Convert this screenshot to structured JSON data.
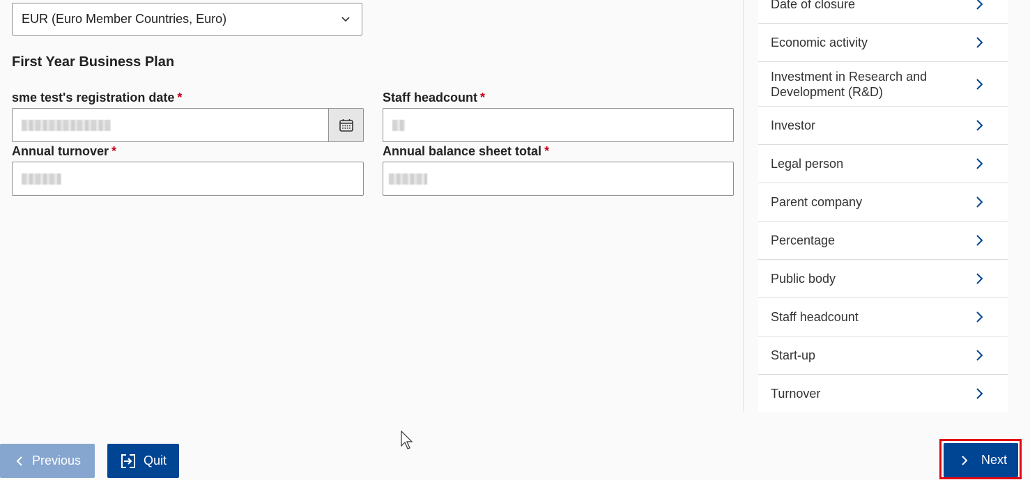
{
  "form": {
    "currency": {
      "selected": "EUR (Euro Member Countries, Euro)"
    },
    "section_title": "First Year Business Plan",
    "fields": {
      "registration_date": {
        "label": "sme test's registration date",
        "required_mark": "*"
      },
      "staff_headcount": {
        "label": "Staff headcount",
        "required_mark": "*"
      },
      "annual_turnover": {
        "label": "Annual turnover",
        "required_mark": "*"
      },
      "balance_sheet_total": {
        "label": "Annual balance sheet total",
        "required_mark": "*"
      }
    }
  },
  "sidebar": {
    "items": [
      {
        "label": "Date of closure"
      },
      {
        "label": "Economic activity"
      },
      {
        "label": "Investment in Research and Development (R&D)"
      },
      {
        "label": "Investor"
      },
      {
        "label": "Legal person"
      },
      {
        "label": "Parent company"
      },
      {
        "label": "Percentage"
      },
      {
        "label": "Public body"
      },
      {
        "label": "Staff headcount"
      },
      {
        "label": "Start-up"
      },
      {
        "label": "Turnover"
      }
    ]
  },
  "footer": {
    "previous_label": "Previous",
    "quit_label": "Quit",
    "next_label": "Next"
  },
  "icons": {
    "currency_dropdown": "chevron-down-icon",
    "date_picker": "calendar-icon",
    "sidebar_item": "chevron-right-icon",
    "previous": "chevron-left-icon",
    "quit": "exit-icon",
    "next": "chevron-right-icon"
  },
  "colors": {
    "primary": "#004494",
    "primary_disabled": "#86a6cf",
    "required": "#c4001e",
    "highlight": "#e30613"
  }
}
